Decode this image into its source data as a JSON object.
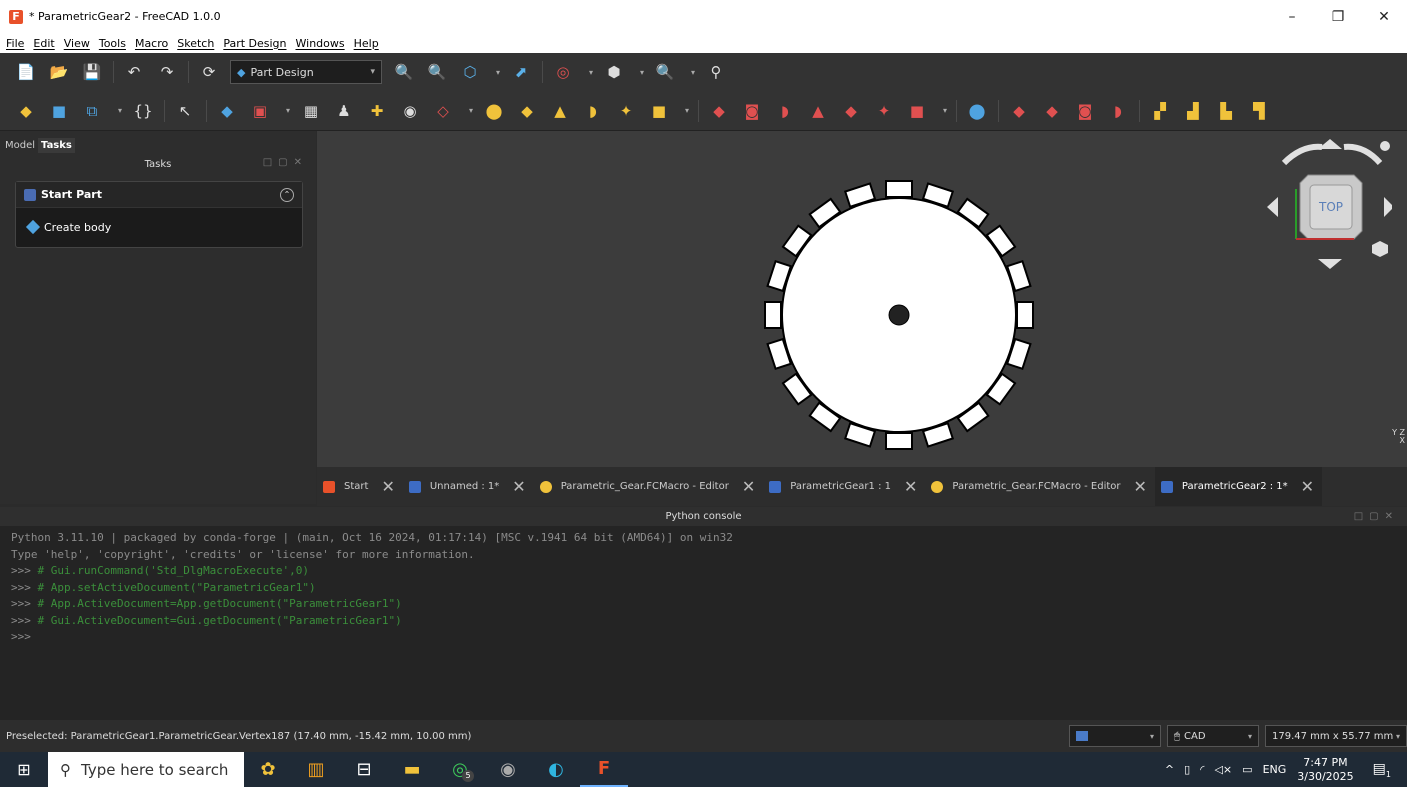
{
  "window": {
    "title": "* ParametricGear2 - FreeCAD 1.0.0",
    "minimize": "–",
    "maximize": "❐",
    "close": "✕"
  },
  "menubar": [
    "File",
    "Edit",
    "View",
    "Tools",
    "Macro",
    "Sketch",
    "Part Design",
    "Windows",
    "Help"
  ],
  "toolbar": {
    "workbench": "Part Design"
  },
  "left_panel": {
    "tabs": [
      "Model",
      "Tasks"
    ],
    "header": "Tasks",
    "task_title": "Start Part",
    "task_item": "Create body"
  },
  "navcube": {
    "face": "TOP",
    "axes": "Y Z X"
  },
  "doc_tabs": [
    {
      "label": "Start",
      "icon_color": "#e8512a"
    },
    {
      "label": "Unnamed : 1*",
      "icon_color": "#3d6cc4"
    },
    {
      "label": "Parametric_Gear.FCMacro - Editor",
      "icon_color": "#f0c23b"
    },
    {
      "label": "ParametricGear1 : 1",
      "icon_color": "#3d6cc4"
    },
    {
      "label": "Parametric_Gear.FCMacro - Editor",
      "icon_color": "#f0c23b"
    },
    {
      "label": "ParametricGear2 : 1*",
      "icon_color": "#3d6cc4"
    }
  ],
  "python_console": {
    "title": "Python console",
    "lines": [
      {
        "text": "Python 3.11.10 | packaged by conda-forge | (main, Oct 16 2024, 01:17:14) [MSC v.1941 64 bit (AMD64)] on win32",
        "type": "plain"
      },
      {
        "text": "Type 'help', 'copyright', 'credits' or 'license' for more information.",
        "type": "plain"
      },
      {
        "prompt": ">>> ",
        "text": "# Gui.runCommand('Std_DlgMacroExecute',0)",
        "type": "comment"
      },
      {
        "prompt": ">>> ",
        "text": "# App.setActiveDocument(\"ParametricGear1\")",
        "type": "comment"
      },
      {
        "prompt": ">>> ",
        "text": "# App.ActiveDocument=App.getDocument(\"ParametricGear1\")",
        "type": "comment"
      },
      {
        "prompt": ">>> ",
        "text": "# Gui.ActiveDocument=Gui.getDocument(\"ParametricGear1\")",
        "type": "comment"
      },
      {
        "prompt": ">>>",
        "text": "",
        "type": "plain"
      }
    ]
  },
  "statusbar": {
    "message": "Preselected: ParametricGear1.ParametricGear.Vertex187 (17.40 mm, -15.42 mm, 10.00 mm)",
    "nav_style": "CAD",
    "dimensions": "179.47 mm x 55.77 mm"
  },
  "taskbar": {
    "search_placeholder": "Type here to search",
    "time": "7:47 PM",
    "date": "3/30/2025",
    "lang": "ENG",
    "notif_count": "1",
    "whatsapp_badge": "5"
  },
  "gear": {
    "teeth": 20
  },
  "colors": {
    "accent": "#3d6cc4",
    "freecad": "#e8512a",
    "viewport": "#3c3c3c",
    "comment": "#3b8f3b"
  }
}
